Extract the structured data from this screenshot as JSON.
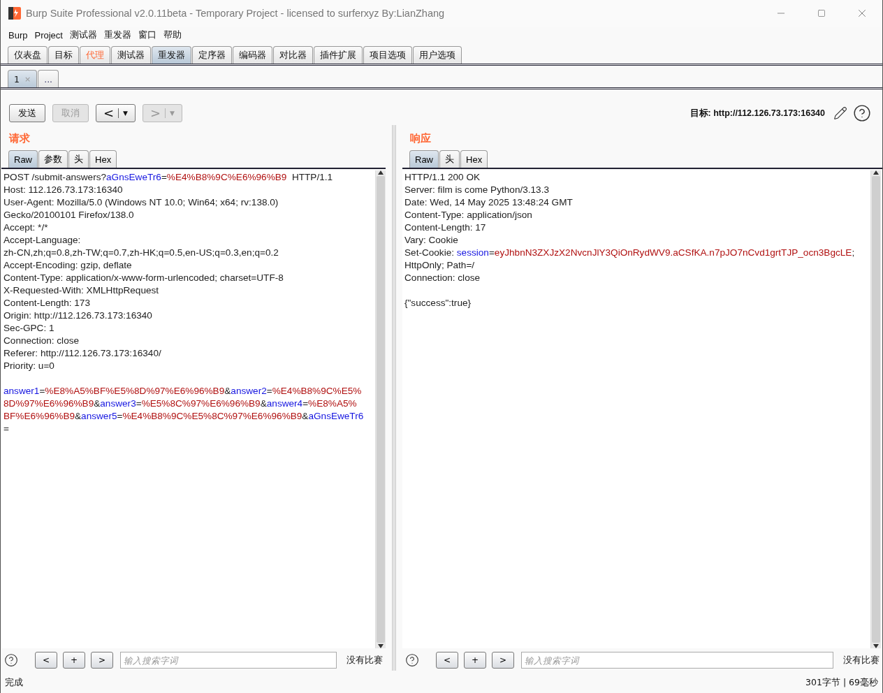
{
  "window": {
    "title": "Burp Suite Professional v2.0.11beta - Temporary Project - licensed to surferxyz By:LianZhang"
  },
  "menu": [
    "Burp",
    "Project",
    "测试器",
    "重发器",
    "窗口",
    "帮助"
  ],
  "main_tabs": [
    {
      "label": "仪表盘",
      "selected": false,
      "highlighted": false
    },
    {
      "label": "目标",
      "selected": false,
      "highlighted": false
    },
    {
      "label": "代理",
      "selected": false,
      "highlighted": true
    },
    {
      "label": "测试器",
      "selected": false,
      "highlighted": false
    },
    {
      "label": "重发器",
      "selected": true,
      "highlighted": false
    },
    {
      "label": "定序器",
      "selected": false,
      "highlighted": false
    },
    {
      "label": "编码器",
      "selected": false,
      "highlighted": false
    },
    {
      "label": "对比器",
      "selected": false,
      "highlighted": false
    },
    {
      "label": "插件扩展",
      "selected": false,
      "highlighted": false
    },
    {
      "label": "项目选项",
      "selected": false,
      "highlighted": false
    },
    {
      "label": "用户选项",
      "selected": false,
      "highlighted": false
    }
  ],
  "sub_tabs": [
    {
      "label": "1",
      "close": "×",
      "selected": true
    },
    {
      "label": "...",
      "selected": false
    }
  ],
  "toolbar": {
    "buttons": [
      {
        "kind": "text",
        "label": "发送",
        "disabled": false
      },
      {
        "kind": "text",
        "label": "取消",
        "disabled": true
      },
      {
        "kind": "nav",
        "label": "<",
        "menu_glyph": "▼",
        "disabled": false
      },
      {
        "kind": "nav",
        "label": ">",
        "menu_glyph": "▼",
        "disabled": true
      }
    ],
    "target": "目标: http://112.126.73.173:16340"
  },
  "panes": [
    {
      "title": "请求",
      "tabs": [
        {
          "label": "Raw",
          "selected": true
        },
        {
          "label": "参数",
          "selected": false
        },
        {
          "label": "头",
          "selected": false
        },
        {
          "label": "Hex",
          "selected": false
        }
      ],
      "headers": [
        [
          {
            "kind": "plain",
            "text": "POST /submit-answers?"
          },
          {
            "kind": "name",
            "text": "aGnsEweTr6"
          },
          {
            "kind": "plain",
            "text": "="
          },
          {
            "kind": "value",
            "text": "%E4%B8%9C%E6%96%B9"
          },
          {
            "kind": "plain",
            "text": "  HTTP/1.1"
          }
        ],
        [
          {
            "kind": "plain",
            "text": "Host: 112.126.73.173:16340"
          }
        ],
        [
          {
            "kind": "plain",
            "text": "User-Agent: Mozilla/5.0 (Windows NT 10.0; Win64; x64; rv:138.0)"
          }
        ],
        [
          {
            "kind": "plain",
            "text": "Gecko/20100101 Firefox/138.0"
          }
        ],
        [
          {
            "kind": "plain",
            "text": "Accept: */*"
          }
        ],
        [
          {
            "kind": "plain",
            "text": "Accept-Language:"
          }
        ],
        [
          {
            "kind": "plain",
            "text": "zh-CN,zh;q=0.8,zh-TW;q=0.7,zh-HK;q=0.5,en-US;q=0.3,en;q=0.2"
          }
        ],
        [
          {
            "kind": "plain",
            "text": "Accept-Encoding: gzip, deflate"
          }
        ],
        [
          {
            "kind": "plain",
            "text": "Content-Type: application/x-www-form-urlencoded; charset=UTF-8"
          }
        ],
        [
          {
            "kind": "plain",
            "text": "X-Requested-With: XMLHttpRequest"
          }
        ],
        [
          {
            "kind": "plain",
            "text": "Content-Length: 173"
          }
        ],
        [
          {
            "kind": "plain",
            "text": "Origin: http://112.126.73.173:16340"
          }
        ],
        [
          {
            "kind": "plain",
            "text": "Sec-GPC: 1"
          }
        ],
        [
          {
            "kind": "plain",
            "text": "Connection: close"
          }
        ],
        [
          {
            "kind": "plain",
            "text": "Referer: http://112.126.73.173:16340/"
          }
        ],
        [
          {
            "kind": "plain",
            "text": "Priority: u=0"
          }
        ]
      ],
      "body": [
        [
          {
            "kind": "name",
            "text": "answer1"
          },
          {
            "kind": "plain",
            "text": "="
          },
          {
            "kind": "value",
            "text": "%E8%A5%BF%E5%8D%97%E6%96%B9"
          },
          {
            "kind": "plain",
            "text": "&"
          },
          {
            "kind": "name",
            "text": "answer2"
          },
          {
            "kind": "plain",
            "text": "="
          },
          {
            "kind": "value",
            "text": "%E4%B8%9C%E5%"
          }
        ],
        [
          {
            "kind": "value",
            "text": "8D%97%E6%96%B9"
          },
          {
            "kind": "plain",
            "text": "&"
          },
          {
            "kind": "name",
            "text": "answer3"
          },
          {
            "kind": "plain",
            "text": "="
          },
          {
            "kind": "value",
            "text": "%E5%8C%97%E6%96%B9"
          },
          {
            "kind": "plain",
            "text": "&"
          },
          {
            "kind": "name",
            "text": "answer4"
          },
          {
            "kind": "plain",
            "text": "="
          },
          {
            "kind": "value",
            "text": "%E8%A5%"
          }
        ],
        [
          {
            "kind": "value",
            "text": "BF%E6%96%B9"
          },
          {
            "kind": "plain",
            "text": "&"
          },
          {
            "kind": "name",
            "text": "answer5"
          },
          {
            "kind": "plain",
            "text": "="
          },
          {
            "kind": "value",
            "text": "%E4%B8%9C%E5%8C%97%E6%96%B9"
          },
          {
            "kind": "plain",
            "text": "&"
          },
          {
            "kind": "name",
            "text": "aGnsEweTr6"
          }
        ],
        [
          {
            "kind": "plain",
            "text": "="
          }
        ]
      ],
      "search": {
        "buttons": [
          "<",
          "+",
          ">"
        ],
        "placeholder": "输入搜索字词",
        "result": "没有比赛"
      }
    },
    {
      "title": "响应",
      "tabs": [
        {
          "label": "Raw",
          "selected": true
        },
        {
          "label": "头",
          "selected": false
        },
        {
          "label": "Hex",
          "selected": false
        }
      ],
      "headers": [
        [
          {
            "kind": "plain",
            "text": "HTTP/1.1 200 OK"
          }
        ],
        [
          {
            "kind": "plain",
            "text": "Server: film is come Python/3.13.3"
          }
        ],
        [
          {
            "kind": "plain",
            "text": "Date: Wed, 14 May 2025 13:48:24 GMT"
          }
        ],
        [
          {
            "kind": "plain",
            "text": "Content-Type: application/json"
          }
        ],
        [
          {
            "kind": "plain",
            "text": "Content-Length: 17"
          }
        ],
        [
          {
            "kind": "plain",
            "text": "Vary: Cookie"
          }
        ],
        [
          {
            "kind": "plain",
            "text": "Set-Cookie: "
          },
          {
            "kind": "name",
            "text": "session"
          },
          {
            "kind": "plain",
            "text": "="
          },
          {
            "kind": "value",
            "text": "eyJhbnN3ZXJzX2NvcnJlY3QiOnRydWV9.aCSfKA.n7pJO7nCvd1grtTJP_ocn3BgcLE"
          },
          {
            "kind": "plain",
            "text": ";"
          }
        ],
        [
          {
            "kind": "plain",
            "text": "HttpOnly; Path=/"
          }
        ],
        [
          {
            "kind": "plain",
            "text": "Connection: close"
          }
        ]
      ],
      "body": [
        [
          {
            "kind": "plain",
            "text": "{\"success\":true}"
          }
        ]
      ],
      "search": {
        "buttons": [
          "<",
          "+",
          ">"
        ],
        "placeholder": "输入搜索字词",
        "result": "没有比赛"
      }
    }
  ],
  "status_bar": {
    "left": "完成",
    "right": "301字节 | 69毫秒"
  }
}
